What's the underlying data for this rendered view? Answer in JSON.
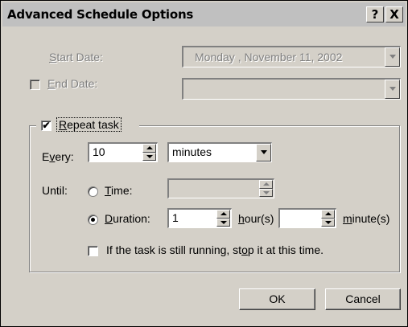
{
  "window": {
    "title": "Advanced Schedule Options",
    "help_glyph": "?",
    "close_glyph": "X"
  },
  "start_date": {
    "label_accel": "S",
    "label_rest": "tart Date:",
    "value": "Monday    , November 11, 2002"
  },
  "end_date": {
    "label_accel": "E",
    "label_rest": "nd Date:",
    "value": "",
    "checked": false
  },
  "repeat": {
    "label_accel": "R",
    "label_rest": "epeat task",
    "checked": true,
    "check_glyph": "✔"
  },
  "every": {
    "label_pre": "E",
    "label_accel": "v",
    "label_rest": "ery:",
    "value": "10",
    "unit": "minutes"
  },
  "until": {
    "label": "Until:",
    "time": {
      "label_accel": "T",
      "label_rest": "ime:",
      "value": "",
      "selected": false
    },
    "duration": {
      "label_accel": "D",
      "label_rest": "uration:",
      "selected": true,
      "hours_value": "1",
      "hours_accel": "h",
      "hours_rest": "our(s)",
      "minutes_value": "",
      "minutes_accel": "m",
      "minutes_rest": "inute(s)"
    }
  },
  "stop_task": {
    "label_pre": "If the task is still running, st",
    "label_accel": "o",
    "label_rest": "p it at this time.",
    "checked": false
  },
  "buttons": {
    "ok": "OK",
    "cancel": "Cancel"
  }
}
